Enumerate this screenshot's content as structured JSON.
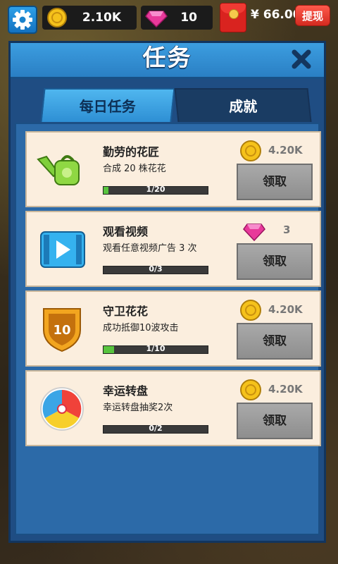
{
  "top_bar": {
    "coins": "2.10K",
    "gems": "10",
    "cash": "¥ 66.00",
    "withdraw_label": "提现"
  },
  "panel": {
    "title": "任务",
    "tabs": [
      {
        "label": "每日任务",
        "active": true
      },
      {
        "label": "成就",
        "active": false
      }
    ]
  },
  "tasks": [
    {
      "title": "勤劳的花匠",
      "desc": "合成 20 株花花",
      "progress_text": "1/20",
      "progress": 0.05,
      "reward_type": "coin",
      "reward": "4.20K",
      "button": "领取",
      "icon": "watering-can-icon"
    },
    {
      "title": "观看视频",
      "desc": "观看任意视频广告 3 次",
      "progress_text": "0/3",
      "progress": 0,
      "reward_type": "gem",
      "reward": "3",
      "button": "领取",
      "icon": "video-icon"
    },
    {
      "title": "守卫花花",
      "desc": "成功抵御10波攻击",
      "progress_text": "1/10",
      "progress": 0.1,
      "reward_type": "coin",
      "reward": "4.20K",
      "button": "领取",
      "icon": "shield-badge-icon"
    },
    {
      "title": "幸运转盘",
      "desc": "幸运转盘抽奖2次",
      "progress_text": "0/2",
      "progress": 0,
      "reward_type": "coin",
      "reward": "4.20K",
      "button": "领取",
      "icon": "lucky-wheel-icon"
    }
  ],
  "colors": {
    "panel": "#1f4d83",
    "card": "#fbeede",
    "progress_fill": "#58c43e",
    "withdraw": "#e6392c"
  }
}
